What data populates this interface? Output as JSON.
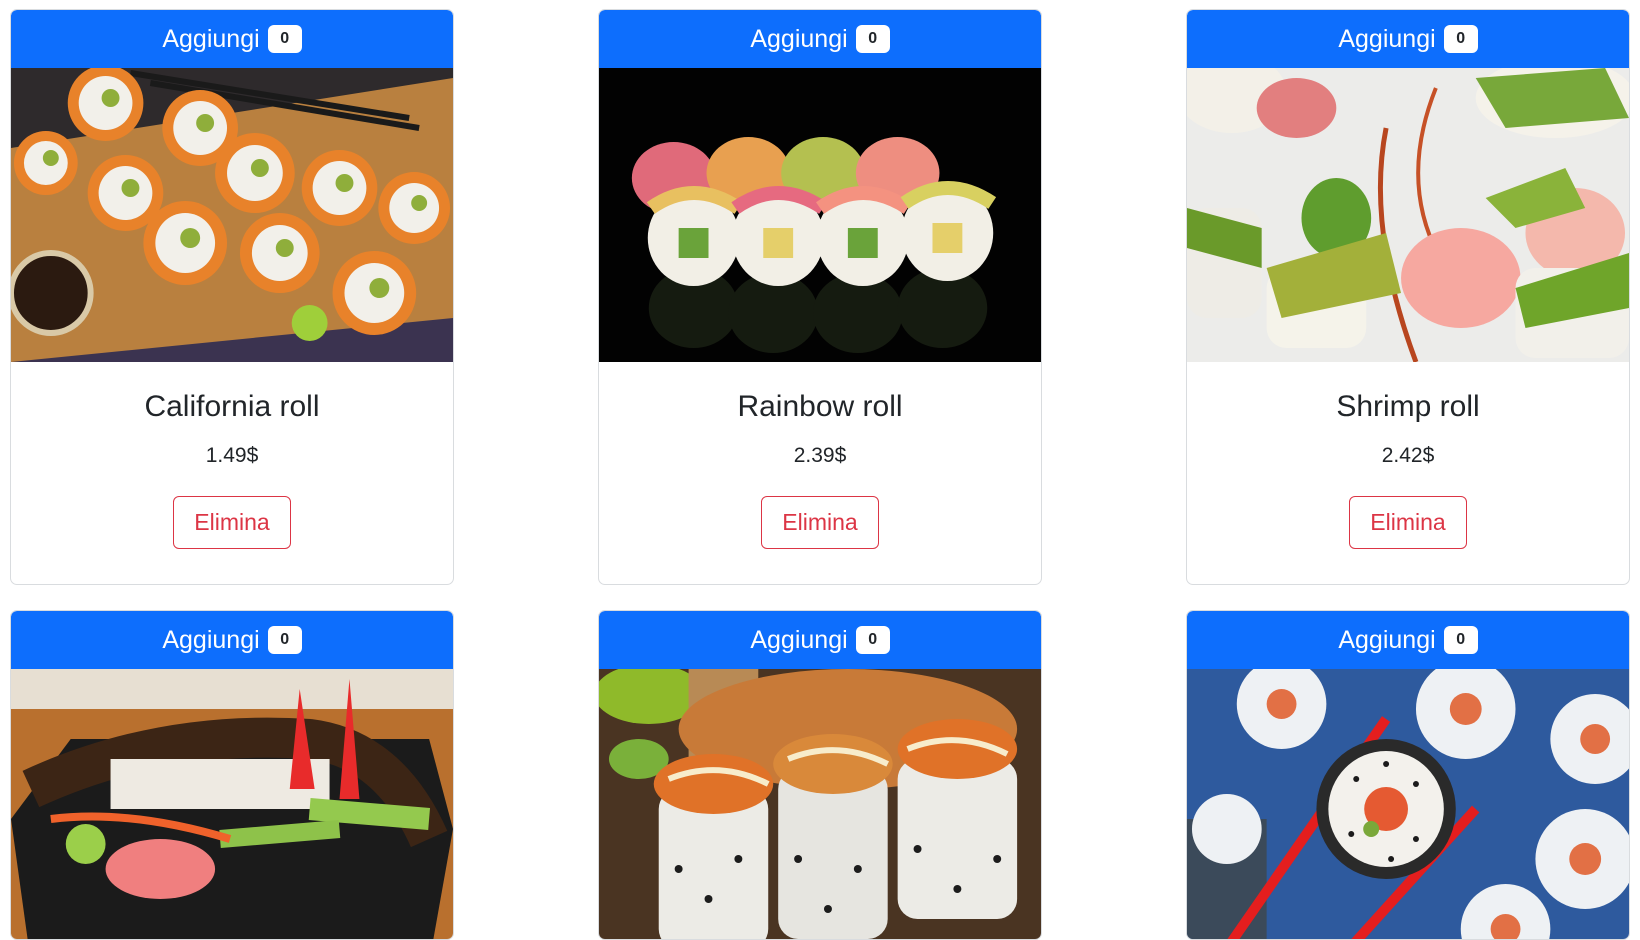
{
  "cards": [
    {
      "add_label": "Aggiungi",
      "count": "0",
      "name": "California roll",
      "price": "1.49$",
      "delete_label": "Elimina"
    },
    {
      "add_label": "Aggiungi",
      "count": "0",
      "name": "Rainbow roll",
      "price": "2.39$",
      "delete_label": "Elimina"
    },
    {
      "add_label": "Aggiungi",
      "count": "0",
      "name": "Shrimp roll",
      "price": "2.42$",
      "delete_label": "Elimina"
    },
    {
      "add_label": "Aggiungi",
      "count": "0"
    },
    {
      "add_label": "Aggiungi",
      "count": "0"
    },
    {
      "add_label": "Aggiungi",
      "count": "0"
    }
  ],
  "colors": {
    "primary": "#0d6efd",
    "danger": "#dc3545"
  }
}
